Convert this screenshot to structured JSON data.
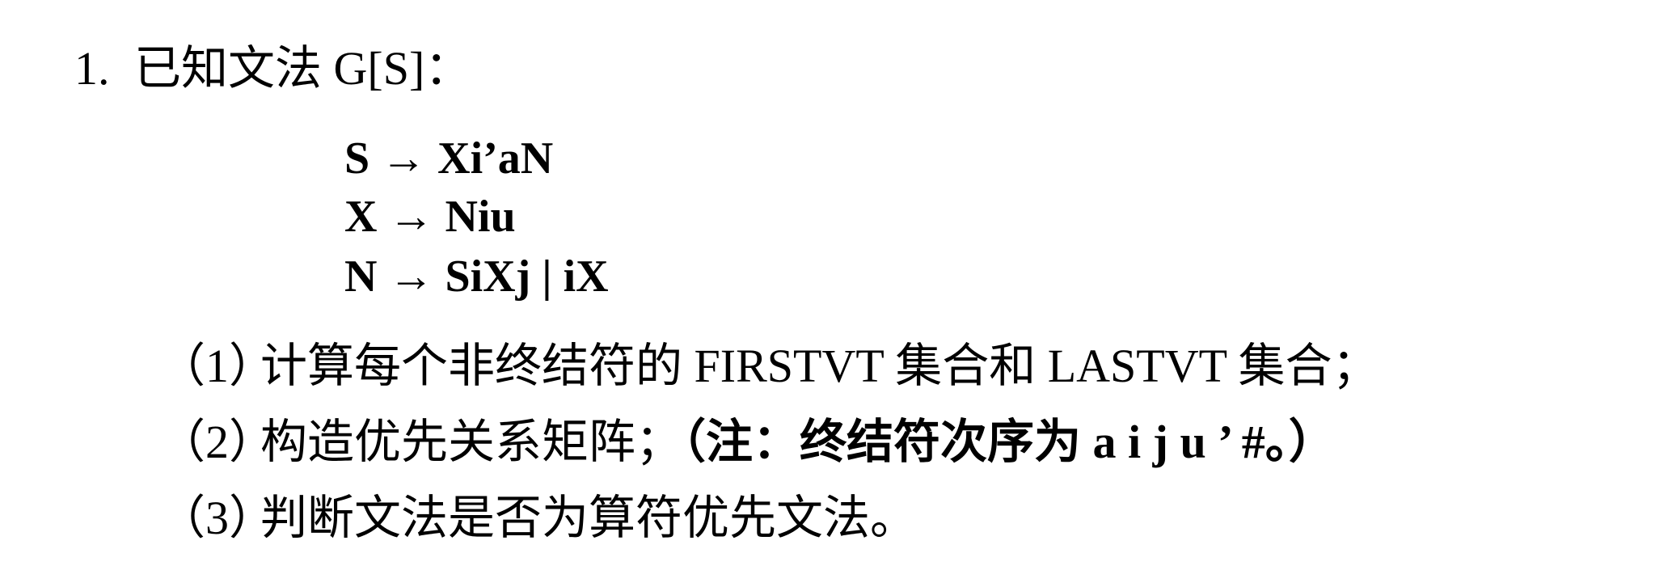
{
  "problem": {
    "number": "1.",
    "title": "已知文法 G[S]："
  },
  "grammar": {
    "rules": [
      "S → Xi’aN",
      "X → Niu",
      "N → SiXj | iX"
    ]
  },
  "questions": [
    {
      "index": "（1）",
      "text": "计算每个非终结符的 FIRSTVT 集合和 LASTVT 集合；"
    },
    {
      "index": "（2）",
      "text": "构造优先关系矩阵；",
      "note": "（注：终结符次序为 a i j u ’ #。）"
    },
    {
      "index": "（3）",
      "text": "判断文法是否为算符优先文法。"
    }
  ]
}
